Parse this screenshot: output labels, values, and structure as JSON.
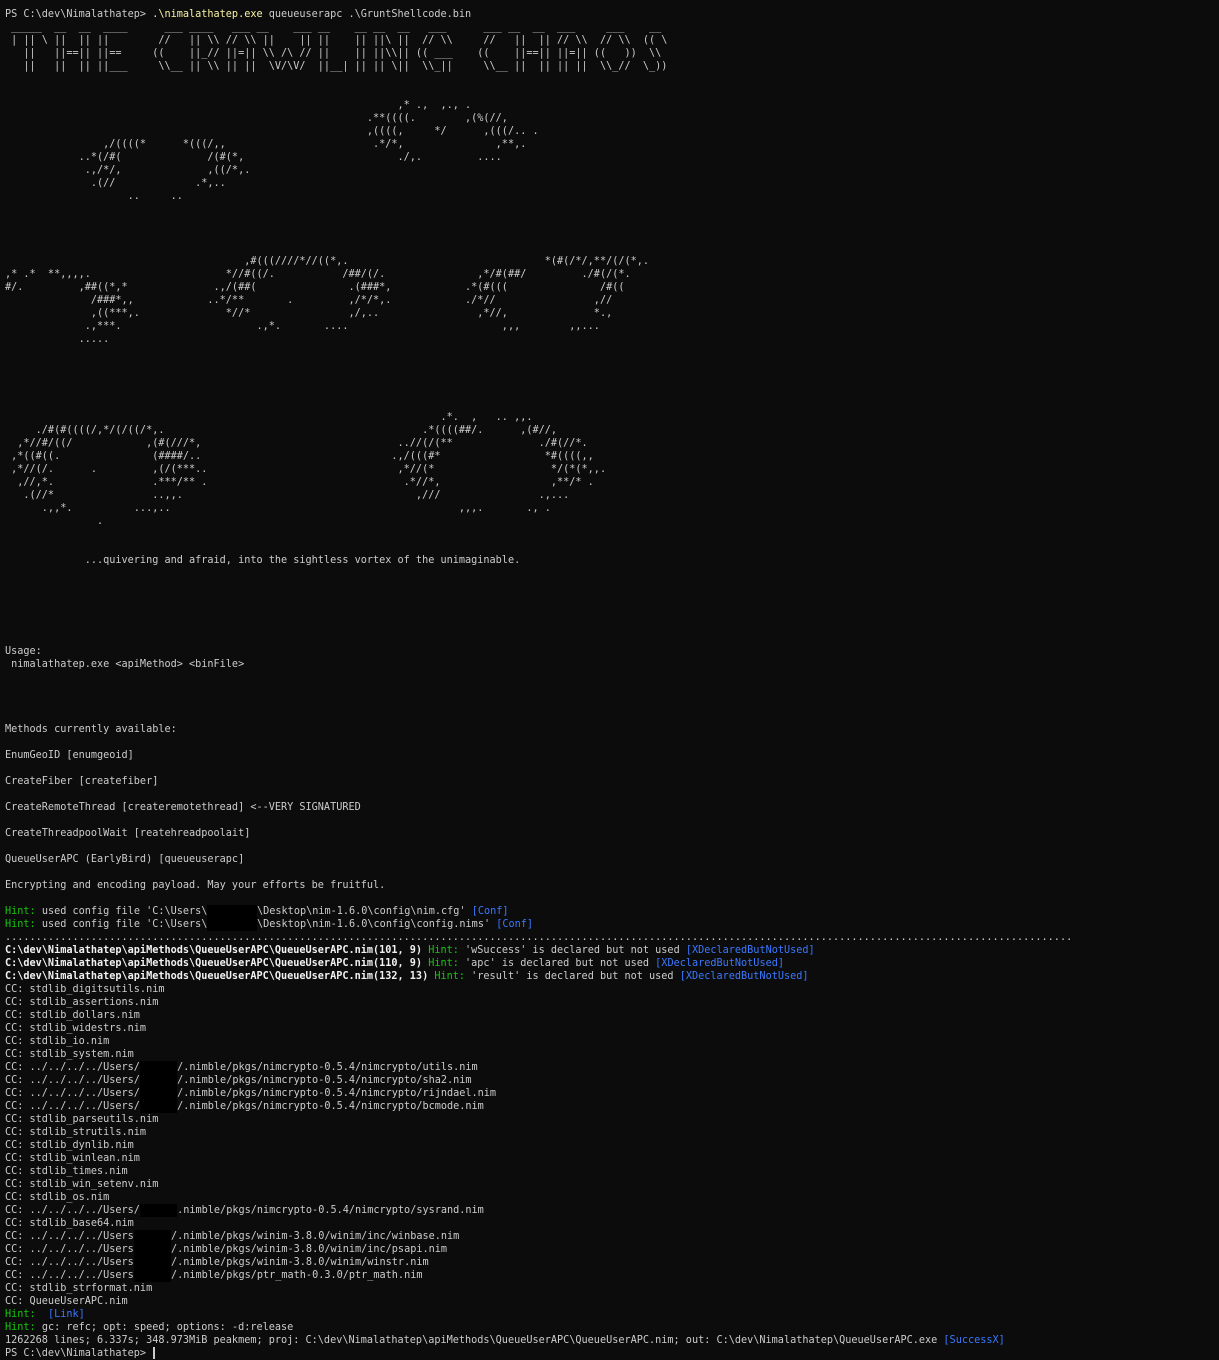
{
  "prompt": "PS C:\\dev\\Nimalathatep> ",
  "command_exe": ".\\nimalathatep.exe",
  "command_args": " queueuserapc .\\GruntShellcode.bin",
  "banner": [
    " _____  __  __  ____      ___ ____   ___ __    ___ __    __ __  __   ___      ___ __  __  ___     ___    __ ",
    " | || \\ ||  || ||        //   || \\\\ // \\\\ ||    || ||    || ||\\ ||  // \\\\     //   ||  || // \\\\  // \\\\  (( \\",
    "   ||   ||==|| ||==     ((    ||_// ||=|| \\\\ /\\ // ||    || ||\\\\|| (( ___    ((    ||==|| ||=|| ((   ))  \\\\ ",
    "   ||   ||  || ||___     \\\\__ || \\\\ || ||  \\V/\\V/  ||__| || || \\||  \\\\_||     \\\\__ ||  || || ||  \\\\_//  \\_))"
  ],
  "art_block_1": [
    "                                                                ,* .,  ,., .",
    "                                                           .**((((.        ,(%(//,",
    "                                                           ,((((,     */      ,(((/.. .",
    "                ,/((((*      *(((/,,                        .*/*,               ,**,.",
    "            ..*(/#(              /(#(*,                         ./,.         ....",
    "             .,/*/,              ,((/*,.",
    "              .(//             .*,..",
    "                    ..     .."
  ],
  "art_block_2": [
    "                                       ,#(((////*//((*,.                                *(#(/*/,**/(/(*,.",
    ",* .*  **,,,,.                      *//#((/.           /##/(/.               ,*/#(##/         ./#(/(*.",
    "#/.         ,##((*,*              .,/(##(               .(###*,            .*(#(((               /#((",
    "              /###*,,            ..*/**       .         ,/*/*,.            ./*//                ,//",
    "              ,((***,.              *//*                ,/,..                ,*//,              *.,",
    "             .,***.                      .,*.       ....                         ,,,        ,,...",
    "            ....."
  ],
  "art_block_3": [
    "                                                                       .*.  ,   .. ,,.",
    "     ./#(#((((/,*/(/((/*,.                                          .*((((##/.      ,(#//,",
    "  ,*//#/((/            ,(#(///*,                                ..//(/(**              ./#(//*.",
    " ,*((#((.               (####/..                               .,/(((#*                 *#((((,,",
    " ,*//(/.      .         ,(/(***..                               ,*//(*                   */(*(*,,.",
    "  ,//,*.                .***/** .                                .*//*,                  ,**/* .",
    "   .(//*                ..,,.                                      ,///                .,...",
    "      .,,*.          ...,..                                               ,,,.       ., .",
    "               ."
  ],
  "tagline": "             ...quivering and afraid, into the sightless vortex of the unimaginable.",
  "usage_title": "Usage:",
  "usage_line": " nimalathatep.exe <apiMethod> <binFile>",
  "methods_title": "Methods currently available:",
  "methods": [
    "EnumGeoID [enumgeoid]",
    "CreateFiber [createfiber]",
    "CreateRemoteThread [createremotethread] <--VERY SIGNATURED",
    "CreateThreadpoolWait [reatehreadpoolait]",
    "QueueUserAPC (EarlyBird) [queueuserapc]"
  ],
  "encrypt_msg": "Encrypting and encoding payload. May your efforts be fruitful.",
  "hint_label": "Hint: ",
  "config_hints": [
    {
      "pre": "used config file 'C:\\Users\\",
      "post": "\\Desktop\\nim-1.6.0\\config\\nim.cfg' ",
      "tag": "[Conf]"
    },
    {
      "pre": "used config file 'C:\\Users\\",
      "post": "\\Desktop\\nim-1.6.0\\config\\config.nims' ",
      "tag": "[Conf]"
    }
  ],
  "dots": "..............................................................................................................................................................................",
  "warnings": [
    {
      "loc": "C:\\dev\\Nimalathatep\\apiMethods\\QueueUserAPC\\QueueUserAPC.nim(101, 9) ",
      "msg": "'wSuccess' is declared but not used ",
      "tag": "[XDeclaredButNotUsed]"
    },
    {
      "loc": "C:\\dev\\Nimalathatep\\apiMethods\\QueueUserAPC\\QueueUserAPC.nim(110, 9) ",
      "msg": "'apc' is declared but not used ",
      "tag": "[XDeclaredButNotUsed]"
    },
    {
      "loc": "C:\\dev\\Nimalathatep\\apiMethods\\QueueUserAPC\\QueueUserAPC.nim(132, 13) ",
      "msg": "'result' is declared but not used ",
      "tag": "[XDeclaredButNotUsed]"
    }
  ],
  "cc_lines": [
    {
      "pre": "CC: stdlib_digitsutils.nim",
      "post": ""
    },
    {
      "pre": "CC: stdlib_assertions.nim",
      "post": ""
    },
    {
      "pre": "CC: stdlib_dollars.nim",
      "post": ""
    },
    {
      "pre": "CC: stdlib_widestrs.nim",
      "post": ""
    },
    {
      "pre": "CC: stdlib_io.nim",
      "post": ""
    },
    {
      "pre": "CC: stdlib_system.nim",
      "post": ""
    },
    {
      "pre": "CC: ../../../../Users/",
      "post": "/.nimble/pkgs/nimcrypto-0.5.4/nimcrypto/utils.nim"
    },
    {
      "pre": "CC: ../../../../Users/",
      "post": "/.nimble/pkgs/nimcrypto-0.5.4/nimcrypto/sha2.nim"
    },
    {
      "pre": "CC: ../../../../Users/",
      "post": "/.nimble/pkgs/nimcrypto-0.5.4/nimcrypto/rijndael.nim"
    },
    {
      "pre": "CC: ../../../../Users/",
      "post": "/.nimble/pkgs/nimcrypto-0.5.4/nimcrypto/bcmode.nim"
    },
    {
      "pre": "CC: stdlib_parseutils.nim",
      "post": ""
    },
    {
      "pre": "CC: stdlib_strutils.nim",
      "post": ""
    },
    {
      "pre": "CC: stdlib_dynlib.nim",
      "post": ""
    },
    {
      "pre": "CC: stdlib_winlean.nim",
      "post": ""
    },
    {
      "pre": "CC: stdlib_times.nim",
      "post": ""
    },
    {
      "pre": "CC: stdlib_win_setenv.nim",
      "post": ""
    },
    {
      "pre": "CC: stdlib_os.nim",
      "post": ""
    },
    {
      "pre": "CC: ../../../../Users/",
      "post": ".nimble/pkgs/nimcrypto-0.5.4/nimcrypto/sysrand.nim"
    },
    {
      "pre": "CC: stdlib_base64.nim",
      "post": ""
    },
    {
      "pre": "CC: ../../../../Users",
      "post": "/.nimble/pkgs/winim-3.8.0/winim/inc/winbase.nim"
    },
    {
      "pre": "CC: ../../../../Users",
      "post": "/.nimble/pkgs/winim-3.8.0/winim/inc/psapi.nim"
    },
    {
      "pre": "CC: ../../../../Users",
      "post": "/.nimble/pkgs/winim-3.8.0/winim/winstr.nim"
    },
    {
      "pre": "CC: ../../../../Users",
      "post": "/.nimble/pkgs/ptr_math-0.3.0/ptr_math.nim"
    },
    {
      "pre": "CC: stdlib_strformat.nim",
      "post": ""
    },
    {
      "pre": "CC: QueueUserAPC.nim",
      "post": ""
    }
  ],
  "link_hint_tag": " [Link]",
  "gc_hint": "gc: refc; opt: speed; options: -d:release",
  "summary": "1262268 lines; 6.337s; 348.973MiB peakmem; proj: C:\\dev\\Nimalathatep\\apiMethods\\QueueUserAPC\\QueueUserAPC.nim; out: C:\\dev\\Nimalathatep\\QueueUserAPC.exe ",
  "success_tag": "[SuccessX]",
  "final_prompt": "PS C:\\dev\\Nimalathatep> ",
  "colors": {
    "background": "#0c0c0c",
    "text": "#cccccc",
    "command": "#f9f1a5",
    "hint": "#16c60c",
    "tag": "#3b78ff"
  }
}
